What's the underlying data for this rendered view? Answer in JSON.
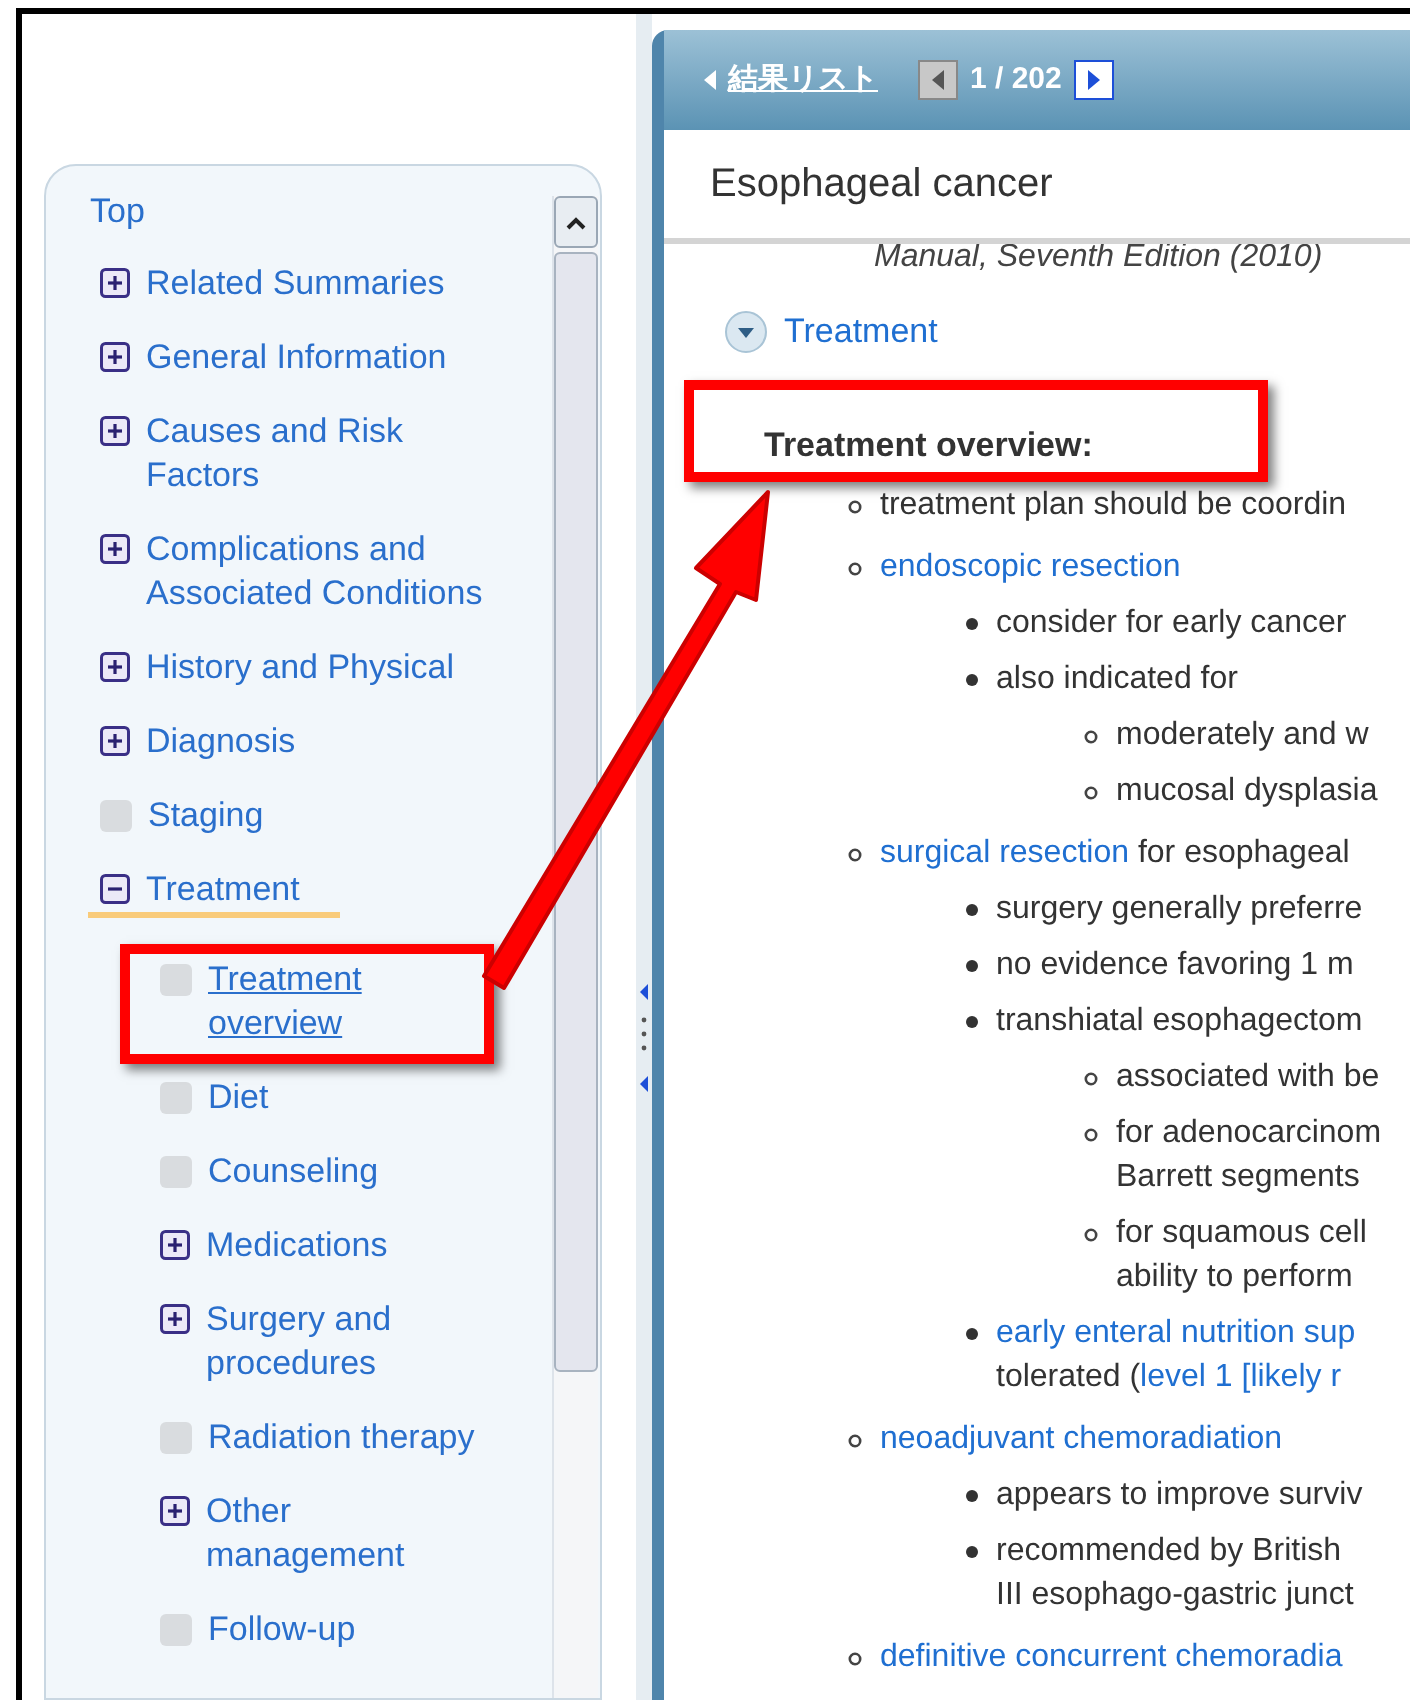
{
  "header": {
    "back_link": "結果リスト",
    "pager": {
      "text": "1 / 202",
      "prev_disabled": true,
      "next_disabled": false
    }
  },
  "document": {
    "title": "Esophageal cancer",
    "cut_line": "Manual, Seventh Edition (2010)",
    "section": {
      "label": "Treatment",
      "expanded": true
    },
    "heading": "Treatment overview:",
    "outline": [
      {
        "lines": [
          [
            {
              "text": "treatment plan should be coordin",
              "link": false
            }
          ]
        ]
      },
      {
        "lines": [
          [
            {
              "text": "endoscopic resection",
              "link": true
            }
          ]
        ],
        "children": [
          {
            "lines": [
              [
                {
                  "text": "consider for early cancer",
                  "link": false
                }
              ]
            ]
          },
          {
            "lines": [
              [
                {
                  "text": "also indicated for",
                  "link": false
                }
              ]
            ],
            "children": [
              {
                "lines": [
                  [
                    {
                      "text": "moderately and w",
                      "link": false
                    }
                  ]
                ]
              },
              {
                "lines": [
                  [
                    {
                      "text": "mucosal dysplasia",
                      "link": false
                    }
                  ]
                ]
              }
            ]
          }
        ]
      },
      {
        "lines": [
          [
            {
              "text": "surgical resection",
              "link": true
            },
            {
              "text": " for esophageal",
              "link": false
            }
          ]
        ],
        "children": [
          {
            "lines": [
              [
                {
                  "text": "surgery generally preferre",
                  "link": false
                }
              ]
            ]
          },
          {
            "lines": [
              [
                {
                  "text": "no evidence favoring 1 m",
                  "link": false
                }
              ]
            ]
          },
          {
            "lines": [
              [
                {
                  "text": "transhiatal esophagectom",
                  "link": false
                }
              ]
            ],
            "children": [
              {
                "lines": [
                  [
                    {
                      "text": "associated with be",
                      "link": false
                    }
                  ]
                ]
              },
              {
                "lines": [
                  [
                    {
                      "text": "for adenocarcinom",
                      "link": false
                    }
                  ],
                  [
                    {
                      "text": "Barrett segments",
                      "link": false
                    }
                  ]
                ]
              },
              {
                "lines": [
                  [
                    {
                      "text": "for squamous cell",
                      "link": false
                    }
                  ],
                  [
                    {
                      "text": "ability to perform",
                      "link": false
                    }
                  ]
                ]
              }
            ]
          },
          {
            "lines": [
              [
                {
                  "text": "early enteral nutrition sup",
                  "link": true
                }
              ],
              [
                {
                  "text": "tolerated (",
                  "link": false
                },
                {
                  "text": "level 1 [likely r",
                  "link": true
                }
              ]
            ]
          }
        ]
      },
      {
        "lines": [
          [
            {
              "text": "neoadjuvant chemoradiation",
              "link": true
            }
          ]
        ],
        "children": [
          {
            "lines": [
              [
                {
                  "text": "appears to improve surviv",
                  "link": false
                }
              ]
            ]
          },
          {
            "lines": [
              [
                {
                  "text": "recommended by British",
                  "link": false
                }
              ],
              [
                {
                  "text": "III esophago-gastric junct",
                  "link": false
                }
              ]
            ]
          }
        ]
      },
      {
        "lines": [
          [
            {
              "text": "definitive concurrent chemoradia",
              "link": true
            }
          ]
        ]
      }
    ]
  },
  "nav": {
    "top_link": "Top",
    "items": [
      {
        "label": "Related Summaries",
        "kind": "expandable",
        "expanded": false,
        "selected": false,
        "highlighted": false
      },
      {
        "label": "General Information",
        "kind": "expandable",
        "expanded": false,
        "selected": false,
        "highlighted": false
      },
      {
        "label": "Causes and Risk Factors",
        "kind": "expandable",
        "expanded": false,
        "selected": false,
        "highlighted": false
      },
      {
        "label": "Complications and Associated Conditions",
        "kind": "expandable",
        "expanded": false,
        "selected": false,
        "highlighted": false
      },
      {
        "label": "History and Physical",
        "kind": "expandable",
        "expanded": false,
        "selected": false,
        "highlighted": false
      },
      {
        "label": "Diagnosis",
        "kind": "expandable",
        "expanded": false,
        "selected": false,
        "highlighted": false
      },
      {
        "label": "Staging",
        "kind": "leaf",
        "selected": false,
        "highlighted": false
      },
      {
        "label": "Treatment",
        "kind": "expandable",
        "expanded": true,
        "selected": false,
        "highlighted": true,
        "children": [
          {
            "label": "Treatment overview",
            "kind": "leaf",
            "selected": true,
            "highlighted": false
          },
          {
            "label": "Diet",
            "kind": "leaf",
            "selected": false,
            "highlighted": false
          },
          {
            "label": "Counseling",
            "kind": "leaf",
            "selected": false,
            "highlighted": false
          },
          {
            "label": "Medications",
            "kind": "expandable",
            "expanded": false,
            "selected": false,
            "highlighted": false
          },
          {
            "label": "Surgery and procedures",
            "kind": "expandable",
            "expanded": false,
            "selected": false,
            "highlighted": false
          },
          {
            "label": "Radiation therapy",
            "kind": "leaf",
            "selected": false,
            "highlighted": false
          },
          {
            "label": "Other management",
            "kind": "expandable",
            "expanded": false,
            "selected": false,
            "highlighted": false
          },
          {
            "label": "Follow-up",
            "kind": "leaf",
            "selected": false,
            "highlighted": false
          }
        ]
      }
    ]
  }
}
